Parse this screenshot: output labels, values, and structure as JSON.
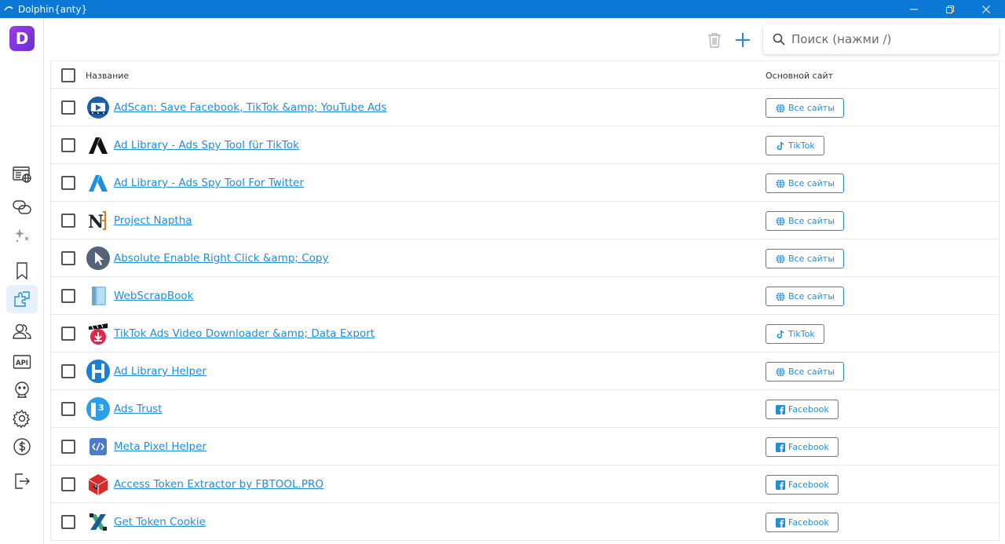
{
  "window": {
    "title": "Dolphin{anty}"
  },
  "sidebar": {
    "logo_letter": "D",
    "items": [
      {
        "name": "browser-profiles",
        "icon": "browser-globe-icon"
      },
      {
        "name": "proxies",
        "icon": "links-icon"
      },
      {
        "name": "automation",
        "icon": "sparkle-icon"
      },
      {
        "name": "bookmarks",
        "icon": "bookmark-icon"
      },
      {
        "name": "extensions",
        "icon": "puzzle-icon",
        "active": true
      },
      {
        "name": "users",
        "icon": "users-icon"
      },
      {
        "name": "api",
        "icon": "api-icon",
        "label": "API"
      },
      {
        "name": "support",
        "icon": "support-icon"
      },
      {
        "name": "settings",
        "icon": "gear-icon"
      },
      {
        "name": "billing",
        "icon": "dollar-icon"
      },
      {
        "name": "logout",
        "icon": "logout-icon"
      }
    ]
  },
  "search": {
    "placeholder": "Поиск (нажми /)"
  },
  "table": {
    "headers": {
      "name": "Название",
      "site": "Основной сайт"
    },
    "rows": [
      {
        "name": "AdScan: Save Facebook, TikTok &amp; YouTube Ads",
        "site": "Все сайты",
        "site_type": "all",
        "icon": "adscan-icon"
      },
      {
        "name": "Ad Library - Ads Spy Tool für TikTok",
        "site": "TikTok",
        "site_type": "tiktok",
        "icon": "ad-library-black-icon"
      },
      {
        "name": "Ad Library - Ads Spy Tool For Twitter",
        "site": "Все сайты",
        "site_type": "all",
        "icon": "ad-library-blue-icon"
      },
      {
        "name": "Project Naptha",
        "site": "Все сайты",
        "site_type": "all",
        "icon": "naptha-icon"
      },
      {
        "name": "Absolute Enable Right Click &amp; Copy",
        "site": "Все сайты",
        "site_type": "all",
        "icon": "cursor-icon"
      },
      {
        "name": "WebScrapBook",
        "site": "Все сайты",
        "site_type": "all",
        "icon": "scrapbook-icon"
      },
      {
        "name": "TikTok Ads Video Downloader &amp; Data Export",
        "site": "TikTok",
        "site_type": "tiktok",
        "icon": "video-download-icon"
      },
      {
        "name": "Ad Library Helper",
        "site": "Все сайты",
        "site_type": "all",
        "icon": "h-circle-icon"
      },
      {
        "name": "Ads Trust",
        "site": "Facebook",
        "site_type": "facebook",
        "icon": "ads-trust-icon"
      },
      {
        "name": "Meta Pixel Helper",
        "site": "Facebook",
        "site_type": "facebook",
        "icon": "code-icon"
      },
      {
        "name": "Access Token Extractor by FBTOOL.PRO",
        "site": "Facebook",
        "site_type": "facebook",
        "icon": "cube-icon"
      },
      {
        "name": "Get Token Cookie",
        "site": "Facebook",
        "site_type": "facebook",
        "icon": "token-cookie-icon"
      }
    ]
  },
  "colors": {
    "titlebar": "#0a78d4",
    "link": "#1f8fd8",
    "logo": "#8a35e0"
  }
}
